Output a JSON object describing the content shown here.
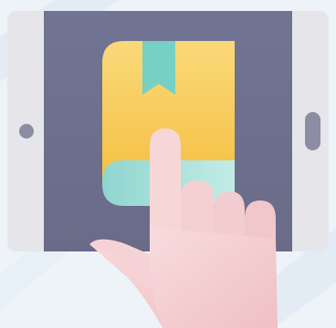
{
  "illustration": {
    "subject": "hand-tapping-ebook-on-tablet",
    "icons": [
      "tablet-icon",
      "book-icon",
      "bookmark-icon",
      "hand-pointer-icon"
    ]
  },
  "colors": {
    "background": "#eef3f8",
    "background_stripes": "#e2ebf4",
    "tablet_bezel": "#e6e6ea",
    "tablet_screen": "#6e6f8e",
    "tablet_button": "#8c8ca2",
    "book_cover_top": "#fad97a",
    "book_cover_bottom": "#f6c54a",
    "book_pages": "#9edbd4",
    "bookmark": "#78cfc4",
    "hand_skin": "#f7d4d6",
    "hand_skin_shadow": "#efbfc4"
  }
}
